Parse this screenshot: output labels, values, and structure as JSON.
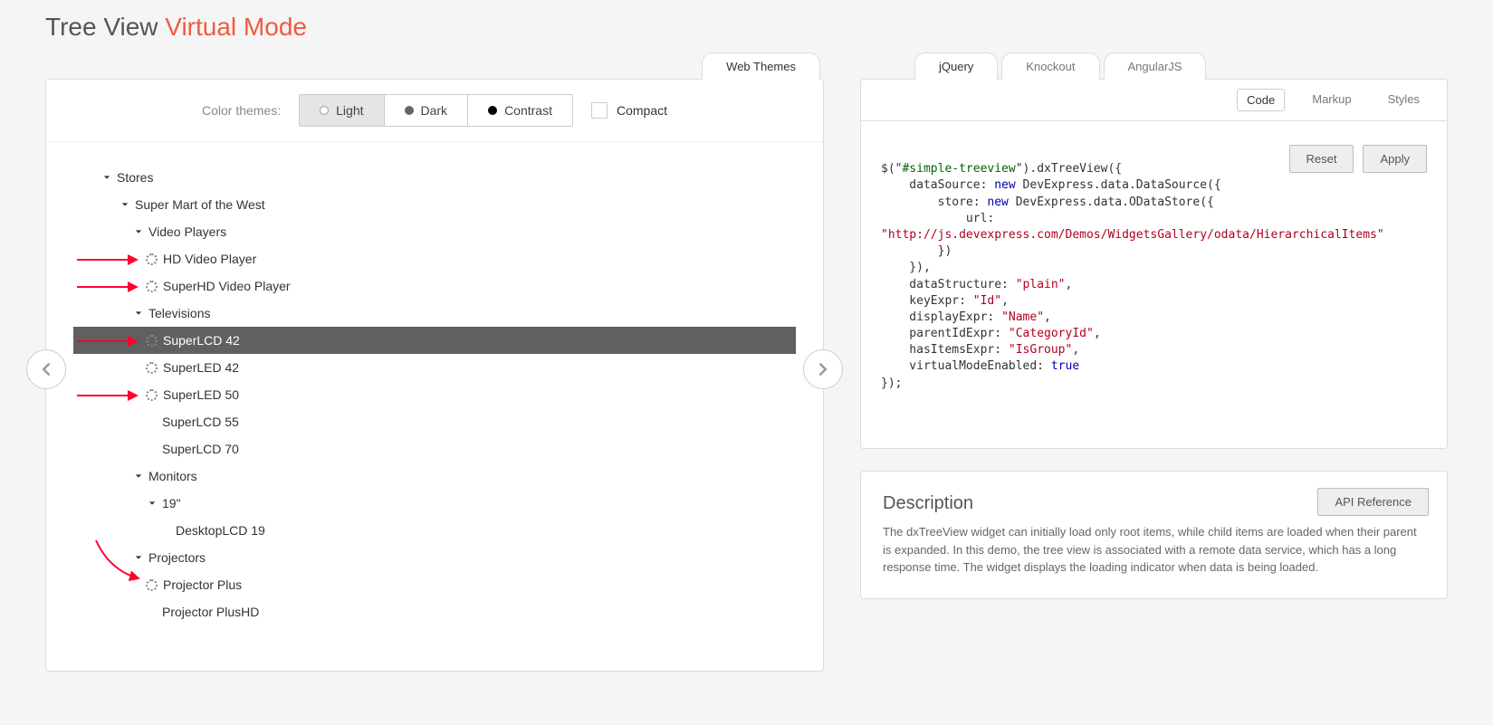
{
  "title": {
    "main": "Tree View",
    "accent": "Virtual Mode"
  },
  "leftTab": "Web Themes",
  "themeBar": {
    "label": "Color themes:",
    "options": [
      "Light",
      "Dark",
      "Contrast"
    ],
    "active": "Light",
    "compact": "Compact"
  },
  "tree": [
    {
      "label": "Stores",
      "indent": 0,
      "chevron": true
    },
    {
      "label": "Super Mart of the West",
      "indent": 1,
      "chevron": true
    },
    {
      "label": "Video Players",
      "indent": 2,
      "chevron": true
    },
    {
      "label": "HD Video Player",
      "indent": 3,
      "spinner": true,
      "arrow": true
    },
    {
      "label": "SuperHD Video Player",
      "indent": 3,
      "spinner": true,
      "arrow": true
    },
    {
      "label": "Televisions",
      "indent": 2,
      "chevron": true
    },
    {
      "label": "SuperLCD 42",
      "indent": 3,
      "spinner": true,
      "selected": true,
      "arrow": true
    },
    {
      "label": "SuperLED 42",
      "indent": 3,
      "spinner": true
    },
    {
      "label": "SuperLED 50",
      "indent": 3,
      "spinner": true,
      "arrow": true
    },
    {
      "label": "SuperLCD 55",
      "indent": 3
    },
    {
      "label": "SuperLCD 70",
      "indent": 3
    },
    {
      "label": "Monitors",
      "indent": 2,
      "chevron": true
    },
    {
      "label": "19\"",
      "indent": 3,
      "chevron": true
    },
    {
      "label": "DesktopLCD 19",
      "indent": 4
    },
    {
      "label": "Projectors",
      "indent": 2,
      "chevron": true,
      "arrowCurve": true
    },
    {
      "label": "Projector Plus",
      "indent": 3,
      "spinner": true
    },
    {
      "label": "Projector PlusHD",
      "indent": 3
    }
  ],
  "frameworkTabs": [
    "jQuery",
    "Knockout",
    "AngularJS"
  ],
  "frameworkActive": "jQuery",
  "subTabs": [
    "Code",
    "Markup",
    "Styles"
  ],
  "subTabActive": "Code",
  "buttons": {
    "reset": "Reset",
    "apply": "Apply",
    "api": "API Reference"
  },
  "code": {
    "l1": "$(\"",
    "l1b": "#simple-treeview",
    "l1c": "\").dxTreeView({",
    "l2": "    dataSource: ",
    "l2b": "new",
    "l2c": " DevExpress.data.DataSource({",
    "l3": "        store: ",
    "l3b": "new",
    "l3c": " DevExpress.data.ODataStore({",
    "l4": "            url:",
    "l5u": "\"http://js.devexpress.com/Demos/WidgetsGallery/odata/HierarchicalItems\"",
    "l6": "        })",
    "l7": "    }),",
    "l8": "    dataStructure: ",
    "l8v": "\"plain\"",
    "l9": "    keyExpr: ",
    "l9v": "\"Id\"",
    "l10": "    displayExpr: ",
    "l10v": "\"Name\"",
    "l11": "    parentIdExpr: ",
    "l11v": "\"CategoryId\"",
    "l12": "    hasItemsExpr: ",
    "l12v": "\"IsGroup\"",
    "l13": "    virtualModeEnabled: ",
    "l13v": "true",
    "l14": "});"
  },
  "description": {
    "heading": "Description",
    "text": "The dxTreeView widget can initially load only root items, while child items are loaded when their parent is expanded. In this demo, the tree view is associated with a remote data service, which has a long response time. The widget displays the loading indicator when data is being loaded."
  }
}
